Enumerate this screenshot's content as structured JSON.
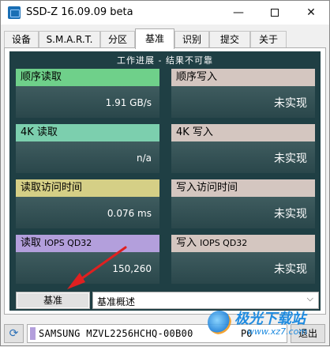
{
  "window": {
    "title": "SSD-Z 16.09.09 beta",
    "controls": {
      "minimize": "—",
      "maximize": "",
      "close": "✕"
    }
  },
  "tabs": [
    {
      "label": "设备",
      "active": false
    },
    {
      "label": "S.M.A.R.T.",
      "active": false
    },
    {
      "label": "分区",
      "active": false
    },
    {
      "label": "基准",
      "active": true
    },
    {
      "label": "识别",
      "active": false
    },
    {
      "label": "提交",
      "active": false
    },
    {
      "label": "关于",
      "active": false
    }
  ],
  "benchmark": {
    "status_title": "工作进展 - 结果不可靠",
    "tiles": [
      {
        "label": "顺序读取",
        "label_sub": "",
        "value": "1.91 GB/s",
        "header_color": "#6fd08a"
      },
      {
        "label": "顺序写入",
        "label_sub": "",
        "value": "未实现",
        "header_color": "#d4c6c0"
      },
      {
        "label": "4K 读取",
        "label_sub": "",
        "value": "n/a",
        "header_color": "#7ccfae"
      },
      {
        "label": "4K 写入",
        "label_sub": "",
        "value": "未实现",
        "header_color": "#d4c6c0"
      },
      {
        "label": "读取访问时间",
        "label_sub": "",
        "value": "0.076 ms",
        "header_color": "#d5cf86"
      },
      {
        "label": "写入访问时间",
        "label_sub": "",
        "value": "未实现",
        "header_color": "#d4c6c0"
      },
      {
        "label": "读取",
        "label_sub": "IOPS QD32",
        "value": "150,260",
        "header_color": "#b39fdc"
      },
      {
        "label": "写入",
        "label_sub": "IOPS QD32",
        "value": "未实现",
        "header_color": "#d4c6c0"
      }
    ],
    "run_button": "基准",
    "mode_select": "基准概述"
  },
  "status_bar": {
    "drive_name": "SAMSUNG MZVL2256HCHQ-00B00",
    "drive_port": "P0",
    "drive_color": "#b39fdc",
    "exit_button": "退出"
  },
  "watermark": {
    "text": "极光下载站",
    "url": "www.xz7.com"
  }
}
